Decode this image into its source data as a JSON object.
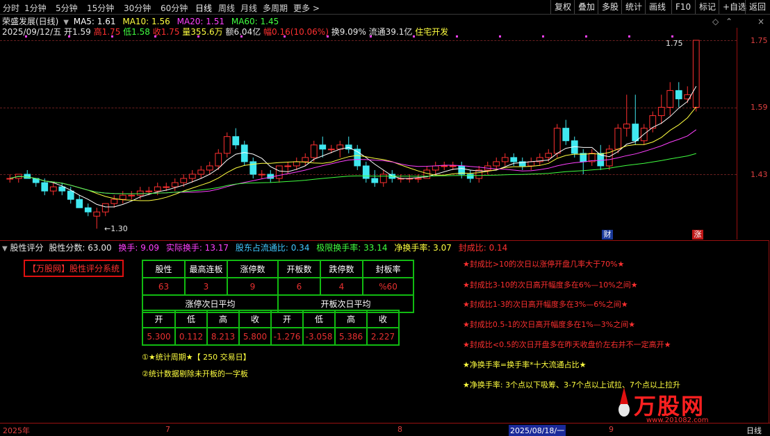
{
  "toolbar": {
    "left_items": [
      "分时",
      "1分钟",
      "5分钟",
      "15分钟",
      "30分钟",
      "60分钟",
      "日线",
      "周线",
      "月线",
      "多周期",
      "更多 >"
    ],
    "right_items": [
      "复权",
      "叠加",
      "多股",
      "统计",
      "画线",
      "F10",
      "标记",
      "+自选",
      "返回"
    ]
  },
  "header": {
    "stock_name": "荣盛发展(日线)",
    "ma": [
      {
        "label": "MA5: 1.61",
        "color": "#ffffff"
      },
      {
        "label": "MA10: 1.56",
        "color": "#ffff40"
      },
      {
        "label": "MA20: 1.51",
        "color": "#ff40ff"
      },
      {
        "label": "MA60: 1.45",
        "color": "#40ff40"
      }
    ],
    "quote_date": "2025/09/12/五",
    "open": "开1.59",
    "high": "高1.75",
    "low": "低1.58",
    "close": "收1.75",
    "volume": "量355.6万",
    "amount": "额6.04亿",
    "change": "幅0.16(10.06%)",
    "turnover": "换9.09%",
    "float": "流通39.1亿",
    "industry": "住宅开发"
  },
  "chart": {
    "price_labels": [
      "1.75",
      "1.59",
      "1.43"
    ],
    "last_price_tag": "1.75",
    "low_marker": "1.30",
    "badge_cai": "财",
    "badge_zhang": "涨",
    "colors": {
      "up": "#ff3030",
      "down": "#40e8f0",
      "ma5": "#ffffff",
      "ma10": "#ffff40",
      "ma20": "#ff40ff",
      "ma60": "#40ff40"
    }
  },
  "chart_data": {
    "type": "candlestick",
    "title": "荣盛发展(日线)",
    "ylim": [
      1.28,
      1.78
    ],
    "candles": [
      [
        1.42,
        1.43,
        1.41,
        1.42
      ],
      [
        1.42,
        1.43,
        1.41,
        1.43
      ],
      [
        1.43,
        1.44,
        1.42,
        1.42
      ],
      [
        1.42,
        1.42,
        1.4,
        1.41
      ],
      [
        1.41,
        1.42,
        1.38,
        1.39
      ],
      [
        1.39,
        1.41,
        1.38,
        1.4
      ],
      [
        1.4,
        1.41,
        1.38,
        1.39
      ],
      [
        1.39,
        1.4,
        1.36,
        1.37
      ],
      [
        1.37,
        1.38,
        1.35,
        1.35
      ],
      [
        1.35,
        1.36,
        1.33,
        1.34
      ],
      [
        1.33,
        1.35,
        1.3,
        1.34
      ],
      [
        1.34,
        1.36,
        1.33,
        1.36
      ],
      [
        1.36,
        1.38,
        1.35,
        1.37
      ],
      [
        1.37,
        1.39,
        1.36,
        1.38
      ],
      [
        1.38,
        1.39,
        1.37,
        1.38
      ],
      [
        1.38,
        1.4,
        1.37,
        1.39
      ],
      [
        1.39,
        1.4,
        1.38,
        1.39
      ],
      [
        1.39,
        1.41,
        1.38,
        1.4
      ],
      [
        1.4,
        1.41,
        1.39,
        1.4
      ],
      [
        1.4,
        1.42,
        1.39,
        1.41
      ],
      [
        1.41,
        1.43,
        1.4,
        1.42
      ],
      [
        1.42,
        1.44,
        1.41,
        1.43
      ],
      [
        1.43,
        1.45,
        1.42,
        1.44
      ],
      [
        1.44,
        1.46,
        1.43,
        1.45
      ],
      [
        1.45,
        1.49,
        1.44,
        1.48
      ],
      [
        1.48,
        1.53,
        1.47,
        1.52
      ],
      [
        1.52,
        1.54,
        1.49,
        1.5
      ],
      [
        1.5,
        1.51,
        1.45,
        1.46
      ],
      [
        1.46,
        1.47,
        1.42,
        1.43
      ],
      [
        1.43,
        1.44,
        1.42,
        1.43
      ],
      [
        1.43,
        1.44,
        1.41,
        1.42
      ],
      [
        1.42,
        1.45,
        1.41,
        1.45
      ],
      [
        1.45,
        1.46,
        1.43,
        1.45
      ],
      [
        1.45,
        1.47,
        1.44,
        1.46
      ],
      [
        1.46,
        1.48,
        1.45,
        1.47
      ],
      [
        1.47,
        1.51,
        1.46,
        1.5
      ],
      [
        1.5,
        1.52,
        1.47,
        1.49
      ],
      [
        1.49,
        1.5,
        1.48,
        1.49
      ],
      [
        1.49,
        1.51,
        1.47,
        1.5
      ],
      [
        1.5,
        1.52,
        1.48,
        1.49
      ],
      [
        1.49,
        1.5,
        1.44,
        1.45
      ],
      [
        1.45,
        1.46,
        1.41,
        1.42
      ],
      [
        1.42,
        1.44,
        1.4,
        1.41
      ],
      [
        1.41,
        1.44,
        1.4,
        1.43
      ],
      [
        1.43,
        1.44,
        1.41,
        1.42
      ],
      [
        1.42,
        1.43,
        1.41,
        1.42
      ],
      [
        1.42,
        1.43,
        1.41,
        1.42
      ],
      [
        1.42,
        1.43,
        1.41,
        1.42
      ],
      [
        1.42,
        1.45,
        1.42,
        1.44
      ],
      [
        1.44,
        1.46,
        1.43,
        1.45
      ],
      [
        1.45,
        1.46,
        1.44,
        1.45
      ],
      [
        1.45,
        1.46,
        1.44,
        1.45
      ],
      [
        1.45,
        1.46,
        1.42,
        1.43
      ],
      [
        1.43,
        1.44,
        1.41,
        1.42
      ],
      [
        1.42,
        1.45,
        1.41,
        1.44
      ],
      [
        1.44,
        1.46,
        1.43,
        1.45
      ],
      [
        1.45,
        1.47,
        1.44,
        1.46
      ],
      [
        1.46,
        1.48,
        1.45,
        1.47
      ],
      [
        1.47,
        1.48,
        1.45,
        1.46
      ],
      [
        1.46,
        1.47,
        1.44,
        1.45
      ],
      [
        1.45,
        1.47,
        1.44,
        1.46
      ],
      [
        1.46,
        1.48,
        1.45,
        1.47
      ],
      [
        1.47,
        1.49,
        1.46,
        1.48
      ],
      [
        1.48,
        1.55,
        1.47,
        1.54
      ],
      [
        1.54,
        1.56,
        1.5,
        1.51
      ],
      [
        1.51,
        1.52,
        1.47,
        1.48
      ],
      [
        1.48,
        1.49,
        1.43,
        1.46
      ],
      [
        1.46,
        1.49,
        1.45,
        1.48
      ],
      [
        1.48,
        1.5,
        1.44,
        1.45
      ],
      [
        1.45,
        1.5,
        1.44,
        1.49
      ],
      [
        1.49,
        1.55,
        1.48,
        1.54
      ],
      [
        1.54,
        1.62,
        1.52,
        1.55
      ],
      [
        1.55,
        1.62,
        1.5,
        1.51
      ],
      [
        1.51,
        1.55,
        1.5,
        1.54
      ],
      [
        1.54,
        1.58,
        1.53,
        1.57
      ],
      [
        1.57,
        1.62,
        1.55,
        1.59
      ],
      [
        1.59,
        1.65,
        1.57,
        1.63
      ],
      [
        1.63,
        1.65,
        1.59,
        1.61
      ],
      [
        1.61,
        1.64,
        1.6,
        1.62
      ],
      [
        1.59,
        1.75,
        1.58,
        1.75
      ]
    ]
  },
  "lower": {
    "panel_title": "股性评分",
    "score_label": "股性分数: 63.00",
    "metrics": [
      {
        "text": "换手: 9.09",
        "color": "#ff40ff"
      },
      {
        "text": "实际换手: 13.17",
        "color": "#ff40ff"
      },
      {
        "text": "股东占流通比: 0.34",
        "color": "#40c8ff"
      },
      {
        "text": "极限换手率: 33.14",
        "color": "#40ff40"
      },
      {
        "text": "净换手率: 3.07",
        "color": "#ffff40"
      },
      {
        "text": "封成比: 0.14",
        "color": "#ff3030"
      }
    ],
    "system_title": "【万股网】股性评分系统",
    "table": {
      "header1": [
        "股性",
        "最高连板",
        "涨停数",
        "开板数",
        "跌停数",
        "封板率"
      ],
      "row1": [
        "63",
        "3",
        "9",
        "6",
        "4",
        "%60"
      ],
      "group_headers": [
        "涨停次日平均",
        "开板次日平均"
      ],
      "header2": [
        "开",
        "低",
        "高",
        "收",
        "开",
        "低",
        "高",
        "收"
      ],
      "row2": [
        "5.300",
        "0.112",
        "8.213",
        "5.800",
        "-1.276",
        "-3.058",
        "5.386",
        "2.227"
      ]
    },
    "footnote1": "①★统计周期★【 250  交易日】",
    "footnote2": "②统计数据剔除未开板的一字板",
    "notes": [
      "★封成比>10的次日以涨停开盘几率大于70%★",
      "★封成比3-10的次日高开幅度多在6%—10%之间★",
      "★封成比1-3的次日高开幅度多在3%—6%之间★",
      "★封成比0.5-1的次日高开幅度多在1%—3%之间★",
      "★封成比<0.5的次日开盘多在昨天收盘价左右并不一定高开★",
      "★净换手率=换手率*十大流通占比★",
      "★净换手率: 3个点以下吸筹、3-7个点以上试拉、7个点以上拉升"
    ],
    "watermark": "万股网",
    "watermark_url": "www.201082.com"
  },
  "datebar": {
    "labels": [
      "2025年",
      "7",
      "8",
      "2025/08/18/一",
      "9"
    ],
    "period": "日线"
  }
}
